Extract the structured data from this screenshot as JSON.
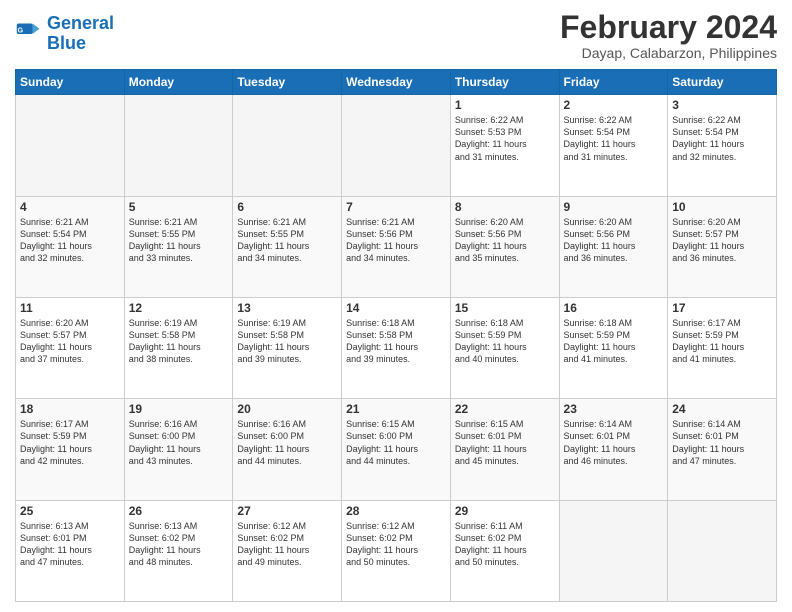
{
  "header": {
    "logo_line1": "General",
    "logo_line2": "Blue",
    "month": "February 2024",
    "location": "Dayap, Calabarzon, Philippines"
  },
  "days_of_week": [
    "Sunday",
    "Monday",
    "Tuesday",
    "Wednesday",
    "Thursday",
    "Friday",
    "Saturday"
  ],
  "weeks": [
    [
      {
        "day": "",
        "info": ""
      },
      {
        "day": "",
        "info": ""
      },
      {
        "day": "",
        "info": ""
      },
      {
        "day": "",
        "info": ""
      },
      {
        "day": "1",
        "info": "Sunrise: 6:22 AM\nSunset: 5:53 PM\nDaylight: 11 hours\nand 31 minutes."
      },
      {
        "day": "2",
        "info": "Sunrise: 6:22 AM\nSunset: 5:54 PM\nDaylight: 11 hours\nand 31 minutes."
      },
      {
        "day": "3",
        "info": "Sunrise: 6:22 AM\nSunset: 5:54 PM\nDaylight: 11 hours\nand 32 minutes."
      }
    ],
    [
      {
        "day": "4",
        "info": "Sunrise: 6:21 AM\nSunset: 5:54 PM\nDaylight: 11 hours\nand 32 minutes."
      },
      {
        "day": "5",
        "info": "Sunrise: 6:21 AM\nSunset: 5:55 PM\nDaylight: 11 hours\nand 33 minutes."
      },
      {
        "day": "6",
        "info": "Sunrise: 6:21 AM\nSunset: 5:55 PM\nDaylight: 11 hours\nand 34 minutes."
      },
      {
        "day": "7",
        "info": "Sunrise: 6:21 AM\nSunset: 5:56 PM\nDaylight: 11 hours\nand 34 minutes."
      },
      {
        "day": "8",
        "info": "Sunrise: 6:20 AM\nSunset: 5:56 PM\nDaylight: 11 hours\nand 35 minutes."
      },
      {
        "day": "9",
        "info": "Sunrise: 6:20 AM\nSunset: 5:56 PM\nDaylight: 11 hours\nand 36 minutes."
      },
      {
        "day": "10",
        "info": "Sunrise: 6:20 AM\nSunset: 5:57 PM\nDaylight: 11 hours\nand 36 minutes."
      }
    ],
    [
      {
        "day": "11",
        "info": "Sunrise: 6:20 AM\nSunset: 5:57 PM\nDaylight: 11 hours\nand 37 minutes."
      },
      {
        "day": "12",
        "info": "Sunrise: 6:19 AM\nSunset: 5:58 PM\nDaylight: 11 hours\nand 38 minutes."
      },
      {
        "day": "13",
        "info": "Sunrise: 6:19 AM\nSunset: 5:58 PM\nDaylight: 11 hours\nand 39 minutes."
      },
      {
        "day": "14",
        "info": "Sunrise: 6:18 AM\nSunset: 5:58 PM\nDaylight: 11 hours\nand 39 minutes."
      },
      {
        "day": "15",
        "info": "Sunrise: 6:18 AM\nSunset: 5:59 PM\nDaylight: 11 hours\nand 40 minutes."
      },
      {
        "day": "16",
        "info": "Sunrise: 6:18 AM\nSunset: 5:59 PM\nDaylight: 11 hours\nand 41 minutes."
      },
      {
        "day": "17",
        "info": "Sunrise: 6:17 AM\nSunset: 5:59 PM\nDaylight: 11 hours\nand 41 minutes."
      }
    ],
    [
      {
        "day": "18",
        "info": "Sunrise: 6:17 AM\nSunset: 5:59 PM\nDaylight: 11 hours\nand 42 minutes."
      },
      {
        "day": "19",
        "info": "Sunrise: 6:16 AM\nSunset: 6:00 PM\nDaylight: 11 hours\nand 43 minutes."
      },
      {
        "day": "20",
        "info": "Sunrise: 6:16 AM\nSunset: 6:00 PM\nDaylight: 11 hours\nand 44 minutes."
      },
      {
        "day": "21",
        "info": "Sunrise: 6:15 AM\nSunset: 6:00 PM\nDaylight: 11 hours\nand 44 minutes."
      },
      {
        "day": "22",
        "info": "Sunrise: 6:15 AM\nSunset: 6:01 PM\nDaylight: 11 hours\nand 45 minutes."
      },
      {
        "day": "23",
        "info": "Sunrise: 6:14 AM\nSunset: 6:01 PM\nDaylight: 11 hours\nand 46 minutes."
      },
      {
        "day": "24",
        "info": "Sunrise: 6:14 AM\nSunset: 6:01 PM\nDaylight: 11 hours\nand 47 minutes."
      }
    ],
    [
      {
        "day": "25",
        "info": "Sunrise: 6:13 AM\nSunset: 6:01 PM\nDaylight: 11 hours\nand 47 minutes."
      },
      {
        "day": "26",
        "info": "Sunrise: 6:13 AM\nSunset: 6:02 PM\nDaylight: 11 hours\nand 48 minutes."
      },
      {
        "day": "27",
        "info": "Sunrise: 6:12 AM\nSunset: 6:02 PM\nDaylight: 11 hours\nand 49 minutes."
      },
      {
        "day": "28",
        "info": "Sunrise: 6:12 AM\nSunset: 6:02 PM\nDaylight: 11 hours\nand 50 minutes."
      },
      {
        "day": "29",
        "info": "Sunrise: 6:11 AM\nSunset: 6:02 PM\nDaylight: 11 hours\nand 50 minutes."
      },
      {
        "day": "",
        "info": ""
      },
      {
        "day": "",
        "info": ""
      }
    ]
  ]
}
